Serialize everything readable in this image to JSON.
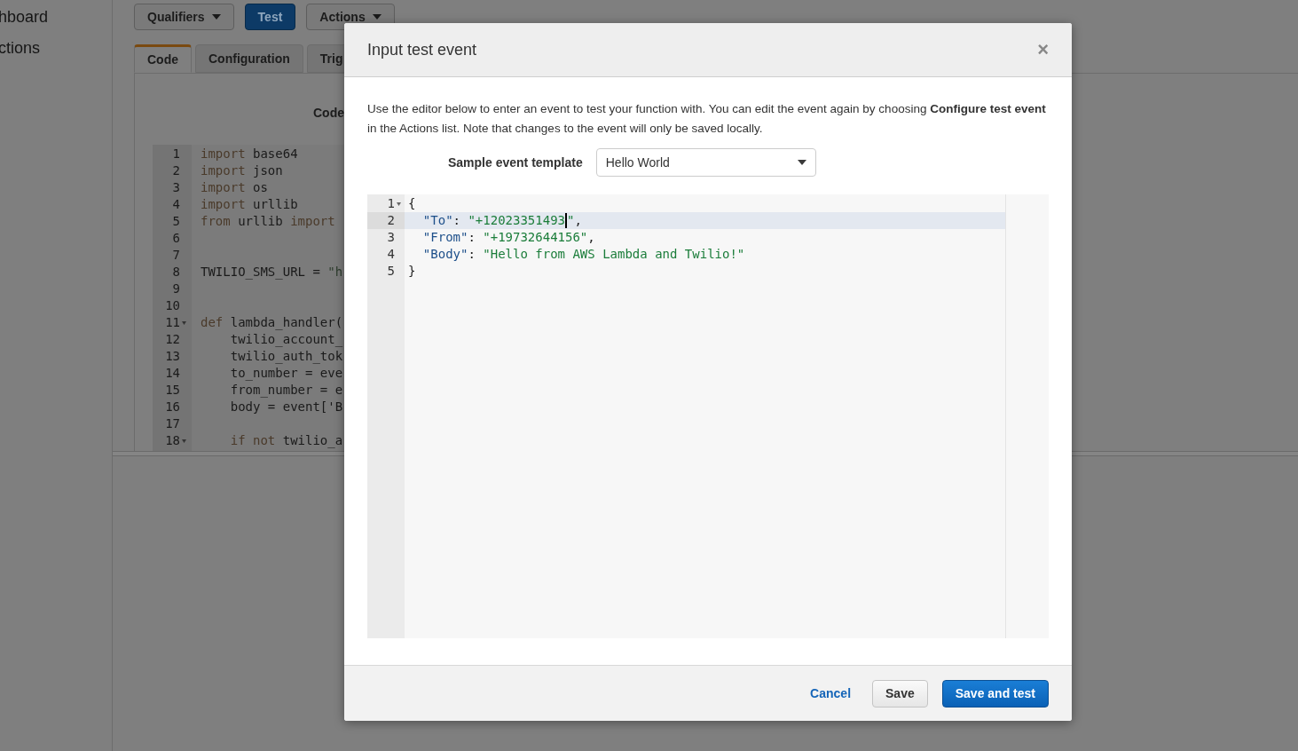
{
  "sidebar": {
    "items": [
      {
        "label": "hboard"
      },
      {
        "label": "ctions"
      }
    ]
  },
  "toolbar": {
    "buttons": [
      {
        "label": "Qualifiers",
        "kind": "dropdown"
      },
      {
        "label": "Test",
        "kind": "primary"
      },
      {
        "label": "Actions",
        "kind": "dropdown"
      }
    ]
  },
  "tabs": [
    {
      "label": "Code",
      "selected": true
    },
    {
      "label": "Configuration",
      "selected": false
    },
    {
      "label": "Trig",
      "selected": false
    }
  ],
  "code_panel": {
    "heading": "Code",
    "lines": [
      {
        "number": "1",
        "tokens": [
          {
            "kind": "kw",
            "text": "import"
          },
          {
            "kind": "plain",
            "text": " base64"
          }
        ]
      },
      {
        "number": "2",
        "tokens": [
          {
            "kind": "kw",
            "text": "import"
          },
          {
            "kind": "plain",
            "text": " json"
          }
        ]
      },
      {
        "number": "3",
        "tokens": [
          {
            "kind": "kw",
            "text": "import"
          },
          {
            "kind": "plain",
            "text": " os"
          }
        ]
      },
      {
        "number": "4",
        "tokens": [
          {
            "kind": "kw",
            "text": "import"
          },
          {
            "kind": "plain",
            "text": " urllib"
          }
        ]
      },
      {
        "number": "5",
        "tokens": [
          {
            "kind": "kw",
            "text": "from"
          },
          {
            "kind": "plain",
            "text": " urllib "
          },
          {
            "kind": "kw",
            "text": "import"
          }
        ]
      },
      {
        "number": "6"
      },
      {
        "number": "7"
      },
      {
        "number": "8",
        "tokens": [
          {
            "kind": "plain",
            "text": "TWILIO_SMS_URL = "
          },
          {
            "kind": "str",
            "text": "\"h"
          }
        ]
      },
      {
        "number": "9"
      },
      {
        "number": "10"
      },
      {
        "number": "11",
        "fold": true,
        "tokens": [
          {
            "kind": "kw",
            "text": "def"
          },
          {
            "kind": "plain",
            "text": " lambda_handler("
          }
        ]
      },
      {
        "number": "12",
        "tokens": [
          {
            "kind": "plain",
            "text": "    twilio_account_"
          }
        ]
      },
      {
        "number": "13",
        "tokens": [
          {
            "kind": "plain",
            "text": "    twilio_auth_tok"
          }
        ]
      },
      {
        "number": "14",
        "tokens": [
          {
            "kind": "plain",
            "text": "    to_number = eve"
          }
        ]
      },
      {
        "number": "15",
        "tokens": [
          {
            "kind": "plain",
            "text": "    from_number = e"
          }
        ]
      },
      {
        "number": "16",
        "tokens": [
          {
            "kind": "plain",
            "text": "    body = event['B"
          }
        ]
      },
      {
        "number": "17"
      },
      {
        "number": "18",
        "fold": true,
        "tokens": [
          {
            "kind": "kw",
            "text": "    if not"
          },
          {
            "kind": "plain",
            "text": " twilio_a"
          }
        ]
      }
    ]
  },
  "dialog": {
    "title": "Input test event",
    "close": "×",
    "description": "Use the editor below to enter an event to test your function with. You can edit the event again by choosing **Configure test event** in the Actions list. Note that changes to the event will only be saved locally.",
    "template_label": "Sample event template",
    "template_value": "Hello World",
    "editor_lines": [
      {
        "number": "1",
        "fold": true,
        "active": false,
        "tokens": [
          {
            "kind": "punct",
            "text": "{"
          }
        ]
      },
      {
        "number": "2",
        "fold": false,
        "active": true,
        "tokens": [
          {
            "kind": "key",
            "text": "  \"To\""
          },
          {
            "kind": "punct",
            "text": ": "
          },
          {
            "kind": "str",
            "text": "\"+12023351493"
          },
          {
            "kind": "cursor"
          },
          {
            "kind": "str",
            "text": "\""
          },
          {
            "kind": "punct",
            "text": ","
          }
        ]
      },
      {
        "number": "3",
        "fold": false,
        "active": false,
        "tokens": [
          {
            "kind": "key",
            "text": "  \"From\""
          },
          {
            "kind": "punct",
            "text": ": "
          },
          {
            "kind": "str",
            "text": "\"+19732644156\""
          },
          {
            "kind": "punct",
            "text": ","
          }
        ]
      },
      {
        "number": "4",
        "fold": false,
        "active": false,
        "tokens": [
          {
            "kind": "key",
            "text": "  \"Body\""
          },
          {
            "kind": "punct",
            "text": ": "
          },
          {
            "kind": "str",
            "text": "\"Hello from AWS Lambda and Twilio!\""
          }
        ]
      },
      {
        "number": "5",
        "fold": false,
        "active": false,
        "tokens": [
          {
            "kind": "punct",
            "text": "}"
          }
        ]
      }
    ],
    "buttons": [
      {
        "label": "Cancel",
        "kind": "link"
      },
      {
        "label": "Save",
        "kind": "default"
      },
      {
        "label": "Save and test",
        "kind": "primary"
      }
    ]
  }
}
